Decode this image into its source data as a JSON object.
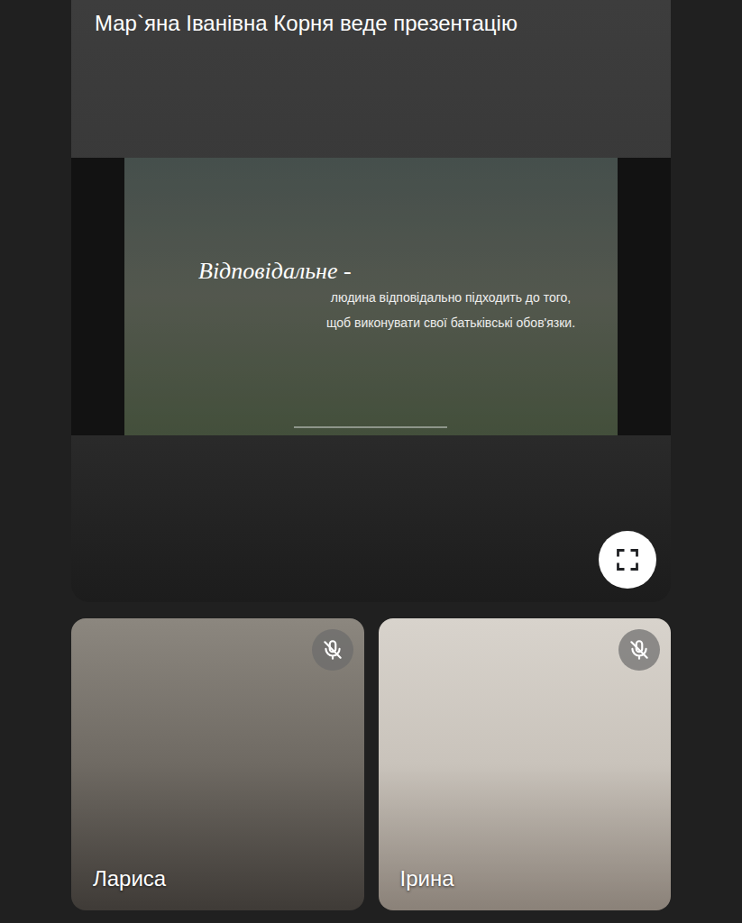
{
  "presentation": {
    "title": "Мар`яна Іванівна Корня веде презентацію",
    "slide": {
      "heading": "Відповідальне -",
      "body": "людина відповідально підходить до того, щоб виконувати свої батьківські обов'язки."
    }
  },
  "participants": [
    {
      "name": "Лариса",
      "muted": true
    },
    {
      "name": "Ірина",
      "muted": true
    }
  ]
}
